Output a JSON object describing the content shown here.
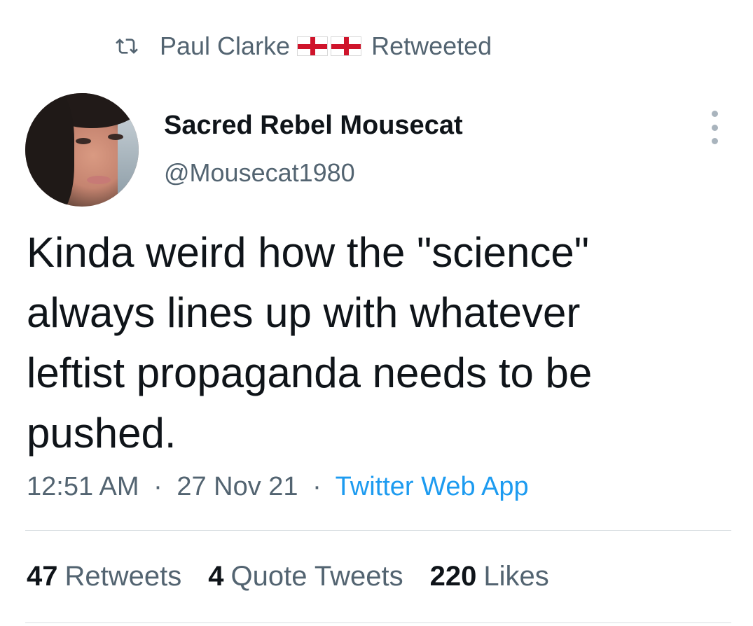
{
  "retweet_context": {
    "icon": "retweet-icon",
    "retweeter_name": "Paul Clarke",
    "flags": [
      "england-flag-icon",
      "england-flag-icon"
    ],
    "label": "Retweeted"
  },
  "author": {
    "display_name": "Sacred Rebel Mousecat",
    "handle": "@Mousecat1980",
    "avatar_icon": "avatar"
  },
  "tweet": {
    "text": "Kinda weird how the \"science\"\nalways lines up with whatever\nleftist propaganda needs to be\npushed."
  },
  "meta": {
    "time": "12:51 AM",
    "separator": "·",
    "date": "27 Nov 21",
    "source": "Twitter Web App"
  },
  "stats": {
    "retweets_count": "47",
    "retweets_label": "Retweets",
    "quotes_count": "4",
    "quotes_label": "Quote Tweets",
    "likes_count": "220",
    "likes_label": "Likes"
  },
  "colors": {
    "text_primary": "#0f1419",
    "text_secondary": "#536471",
    "accent": "#1d9bf0",
    "divider": "#d9dee2"
  }
}
